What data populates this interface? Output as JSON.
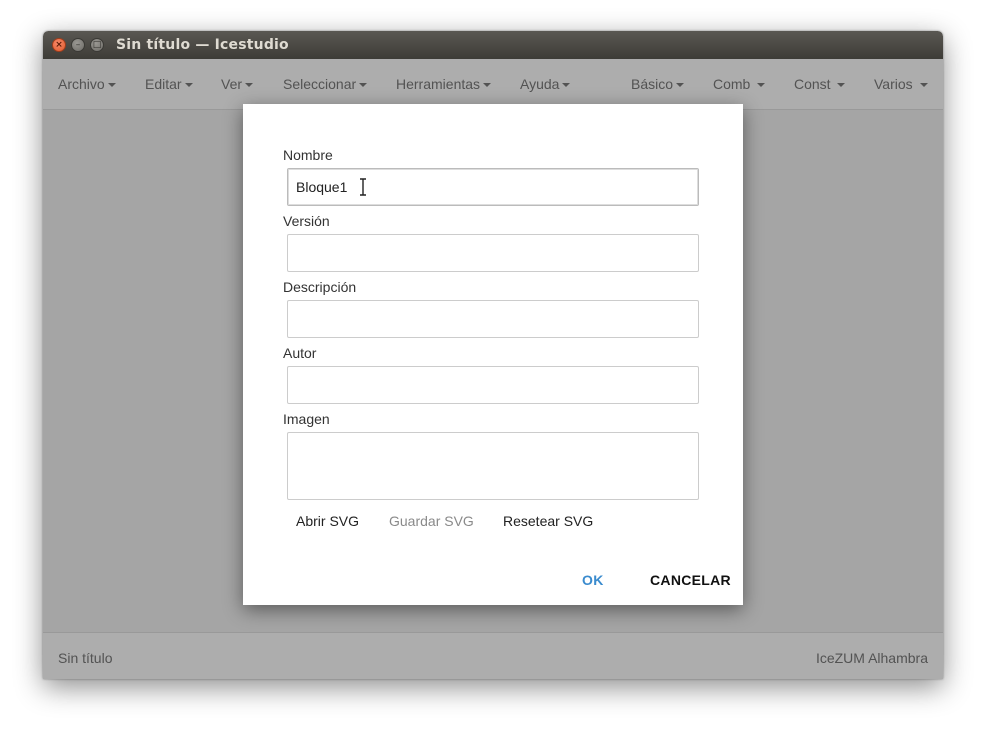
{
  "window": {
    "title": "Sin título — Icestudio",
    "controls": {
      "close_icon": "×",
      "minimize_icon": "–",
      "maximize_icon": "□"
    }
  },
  "menubar": {
    "left": [
      {
        "label": "Archivo"
      },
      {
        "label": "Editar"
      },
      {
        "label": "Ver"
      },
      {
        "label": "Seleccionar"
      },
      {
        "label": "Herramientas"
      },
      {
        "label": "Ayuda"
      }
    ],
    "right": [
      {
        "label": "Básico"
      },
      {
        "label": "Comb"
      },
      {
        "label": "Const"
      },
      {
        "label": "Varios"
      }
    ]
  },
  "status": {
    "left": "Sin título",
    "right": "IceZUM Alhambra"
  },
  "dialog": {
    "fields": {
      "nombre": {
        "label": "Nombre",
        "value": "Bloque1"
      },
      "version": {
        "label": "Versión",
        "value": ""
      },
      "descripcion": {
        "label": "Descripción",
        "value": ""
      },
      "autor": {
        "label": "Autor",
        "value": ""
      },
      "imagen": {
        "label": "Imagen",
        "value": ""
      }
    },
    "svg_buttons": {
      "open": "Abrir SVG",
      "save": "Guardar SVG",
      "reset": "Resetear SVG"
    },
    "ok": "OK",
    "cancel": "CANCELAR"
  },
  "colors": {
    "ok": "#3a8bce",
    "cancel": "#111111",
    "titlebar": "#3d3c37",
    "overlay": "rgba(0,0,0,0.3)"
  }
}
